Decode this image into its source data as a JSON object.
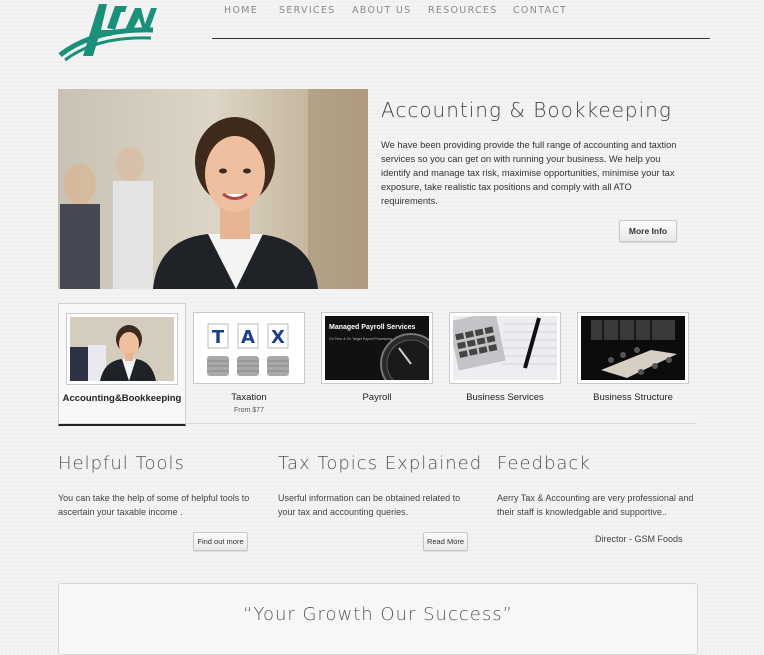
{
  "nav": {
    "items": [
      "HOME",
      "SERVICES",
      "ABOUT US",
      "RESOURCES",
      "CONTACT"
    ]
  },
  "hero": {
    "title": "Accounting & Bookkeeping",
    "text": "We have been providing provide the full range of accounting and taxtion services so you can get on with running your business. We help you identify and manage tax risk, maximise opportunities, minimise your tax exposure, take realistic tax positions and comply with all ATO requirements.",
    "button": "More Info"
  },
  "services": [
    {
      "label": "Accounting&Bookkeeping",
      "sub": ""
    },
    {
      "label": "Taxation",
      "sub": "From $77"
    },
    {
      "label": "Payroll",
      "sub": ""
    },
    {
      "label": "Business Services",
      "sub": ""
    },
    {
      "label": "Business Structure",
      "sub": ""
    }
  ],
  "thumbs": {
    "tax_letters": [
      "T",
      "A",
      "X"
    ],
    "payroll_title": "Managed Payroll Services",
    "payroll_sub": "On Time & On Target Payroll Processing"
  },
  "columns": {
    "tools": {
      "title": "Helpful Tools",
      "text": "You can take the help of some of helpful tools to ascertain your taxable income .",
      "button": "Find out more"
    },
    "tax": {
      "title": "Tax Topics Explained",
      "text": "Userful information can be obtained related to your tax and accounting queries.",
      "button": "Read More"
    },
    "feedback": {
      "title": "Feedback",
      "text": "Aerry Tax & Accounting are very professional and their staff is knowledgable and supportive..",
      "author": "Director - GSM Foods"
    }
  },
  "quote": "“Your Growth Our Success”",
  "colors": {
    "brand_teal": "#1a8f7a",
    "text_dark": "#333333"
  }
}
